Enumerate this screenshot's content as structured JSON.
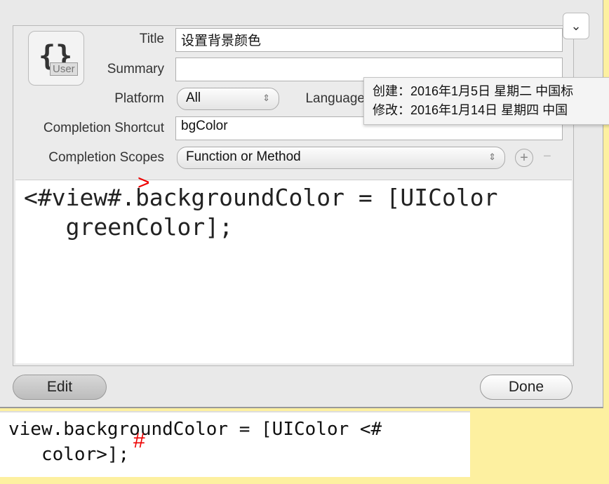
{
  "dialog": {
    "icon_label": "User",
    "labels": {
      "title": "Title",
      "summary": "Summary",
      "platform": "Platform",
      "language": "Language",
      "shortcut": "Completion Shortcut",
      "scopes": "Completion Scopes"
    },
    "title_value": "设置背景颜色",
    "summary_value": "",
    "platform_value": "All",
    "shortcut_value": "bgColor",
    "scopes_value": "Function or Method",
    "code": "<#view#.backgroundColor = [UIColor\n   greenColor];",
    "edit_label": "Edit",
    "done_label": "Done"
  },
  "tooltip": {
    "created": "创建：2016年1月5日 星期二 中国标",
    "modified": "修改：2016年1月14日 星期四 中国"
  },
  "preview": {
    "code": "view.backgroundColor = [UIColor <#\n   color>];"
  },
  "annotations": {
    "mark1": ">",
    "mark2": "#"
  }
}
